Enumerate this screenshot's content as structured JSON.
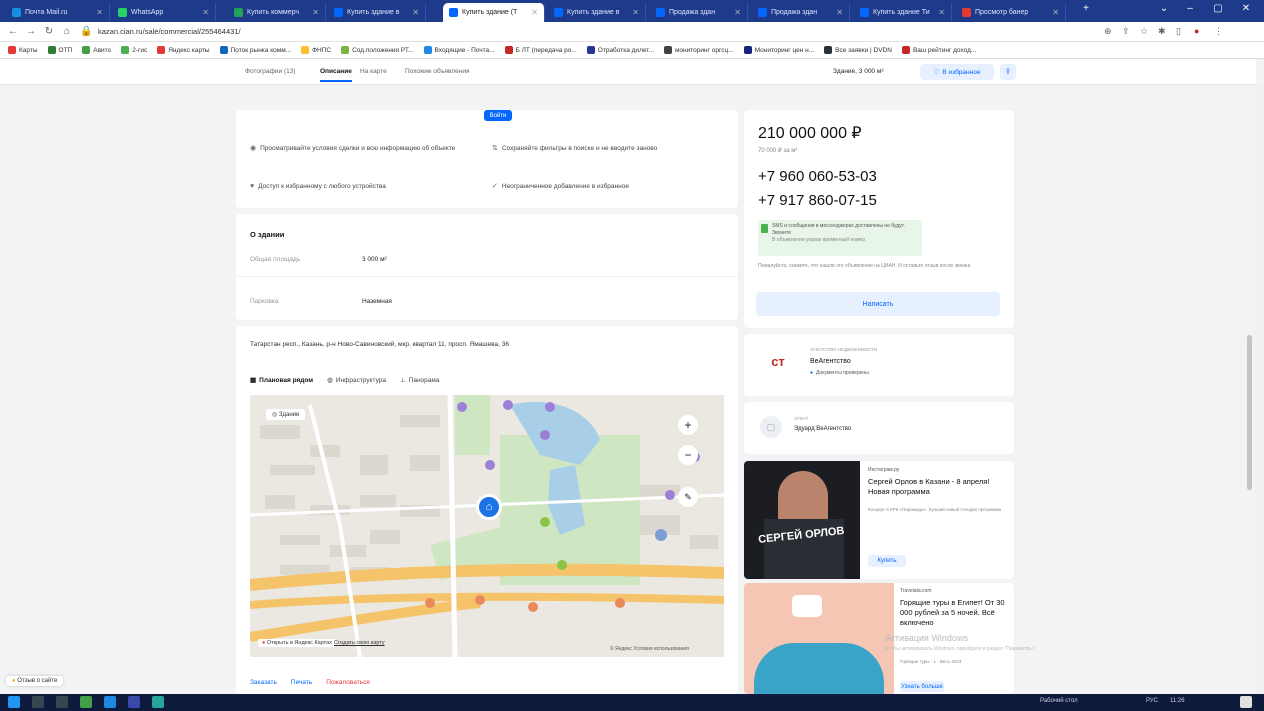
{
  "browser": {
    "tabs": [
      {
        "label": "Почта Mail.ru",
        "color": "#168de2"
      },
      {
        "label": "WhatsApp",
        "color": "#25d366"
      },
      {
        "label": "Купить коммерч",
        "color": "#22a35a"
      },
      {
        "label": "Купить здание в",
        "color": "#0468ff"
      },
      {
        "label": "Купить здание (Т",
        "color": "#0468ff",
        "active": true
      },
      {
        "label": "Купить здание в",
        "color": "#0468ff"
      },
      {
        "label": "Продажа здан",
        "color": "#0468ff"
      },
      {
        "label": "Продажа здан",
        "color": "#0468ff"
      },
      {
        "label": "Купить здание Ти",
        "color": "#0468ff"
      },
      {
        "label": "Просмотр банер",
        "color": "#e53935"
      }
    ],
    "new_tab": "+",
    "url": "kazan.cian.ru/sale/commercial/255464431/",
    "bookmarks": [
      {
        "label": "Карты",
        "color": "#e53935"
      },
      {
        "label": "ОТП",
        "color": "#2e7d32"
      },
      {
        "label": "Авито",
        "color": "#43a047"
      },
      {
        "label": "2-гис",
        "color": "#4caf50"
      },
      {
        "label": "Яндекс карты",
        "color": "#e53935"
      },
      {
        "label": "Поток рынка комм...",
        "color": "#1565c0"
      },
      {
        "label": "ФНПС",
        "color": "#fbc02d"
      },
      {
        "label": "Сод.положения РТ...",
        "color": "#7cb342"
      },
      {
        "label": "Входящие - Почта...",
        "color": "#1e88e5"
      },
      {
        "label": "Б ЛТ (передача ро...",
        "color": "#c62828"
      },
      {
        "label": "Отработка дилет...",
        "color": "#283593"
      },
      {
        "label": "мониторинг оргсц...",
        "color": "#424242"
      },
      {
        "label": "Мониторинг цен н...",
        "color": "#1a237e"
      },
      {
        "label": "Все заявки | DVDN",
        "color": "#263238"
      },
      {
        "label": "Ваш рейтинг доход...",
        "color": "#c62828"
      }
    ]
  },
  "subnav": {
    "items": [
      {
        "label": "Фотографии (13)"
      },
      {
        "label": "Описание",
        "active": true
      },
      {
        "label": "На карте"
      },
      {
        "label": "Похожие объявления"
      }
    ],
    "area_info": "Здание, 3 000 м²",
    "favorite_label": "В избранное",
    "share_icon": "share-icon"
  },
  "login_card": {
    "login_button": "Войти",
    "features": [
      {
        "icon": "eye-icon",
        "text": "Просматривайте условия сделки и всю информацию об объекте"
      },
      {
        "icon": "filter-icon",
        "text": "Сохраняйте фильтры в поиске и не вводите заново"
      },
      {
        "icon": "heart-icon",
        "text": "Доступ к избранному с любого устройства"
      },
      {
        "icon": "check-icon",
        "text": "Неограниченное добавление в избранное"
      }
    ]
  },
  "building": {
    "heading": "О здании",
    "rows": [
      {
        "label": "Общая площадь",
        "value": "3 000 м²"
      },
      {
        "label": "Парковка",
        "value": "Наземная"
      }
    ]
  },
  "address": {
    "text": "Татарстан респ., Казань, р-н Ново-Савиновский, мкр. квартал 11, просп. Ямашева, 36",
    "map_tabs": [
      {
        "label": "Плановая рядом",
        "active": true
      },
      {
        "label": "Инфраструктура"
      },
      {
        "label": "Панорама"
      }
    ],
    "map_chip": "Здание",
    "map_open_label": "Открыть в Яндекс Картах",
    "map_create_label": "Создать свою карту",
    "map_copyright": "© Яндекс Условия использования",
    "bottom_links": [
      "Заказать",
      "Печать",
      "Пожаловаться"
    ]
  },
  "offer": {
    "price": "210 000 000 ₽",
    "price_per_m2": "70 000 ₽ за м²",
    "phones": [
      "+7 960 060-53-03",
      "+7 917 860-07-15"
    ],
    "sms_notice": "SMS и сообщения в мессенджерах доставлены не будут. Звоните",
    "sms_subnote": "В объявлении указан временный номер",
    "disclaimer": "Пожалуйста, скажите, что нашли это объявление на ЦИАН. И оставьте отзыв после звонка",
    "write_button": "Написать"
  },
  "agency": {
    "type": "АГЕНТСТВО НЕДВИЖИМОСТИ",
    "name": "ВеАгентство",
    "verified": "Документы проверены",
    "logo_text": "ст"
  },
  "agent": {
    "role": "АГЕНТ",
    "name": "Эдуард ВеАгентство"
  },
  "ads": [
    {
      "source": "Инстаграм.ру",
      "title": "Сергей Орлов в Казани - 8 апреля! Новая программа",
      "text": "Концерт в КРК «Пирамида». Лучший новый стендап программа",
      "image_caption": "СЕРГЕЙ ОРЛОВ",
      "button": "Купить"
    },
    {
      "source": "Travelata.com",
      "title": "Горящие туры в Египет! От 30 000 рублей за 5 ночей. Всё включено",
      "text": "Горящие туры · 1 · Весь 2023",
      "button": "Узнать больше"
    }
  ],
  "watermark": [
    "Активация Windows",
    "Чтобы активировать Windows, перейдите в раздел \"Параметры\"."
  ],
  "feedback_label": "Отзыв о сайте",
  "taskbar": {
    "tray_text": "Рабочий стол",
    "lang": "РУС",
    "time": "11:26"
  }
}
